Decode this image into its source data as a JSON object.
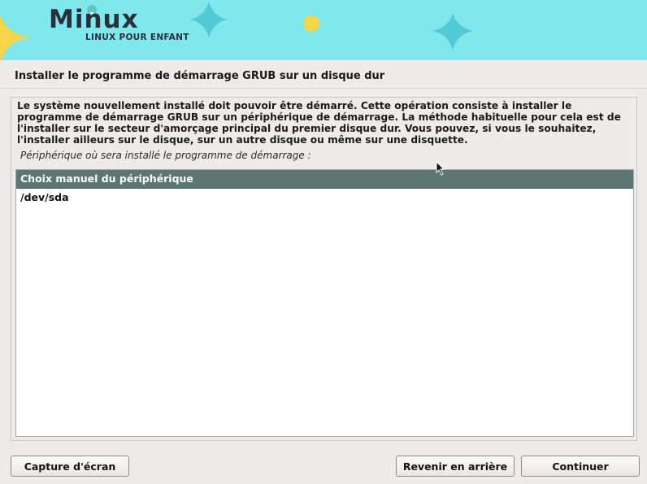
{
  "banner": {
    "logo_title": "Minux",
    "logo_subtitle": "LINUX POUR ENFANT"
  },
  "page": {
    "title": "Installer le programme de démarrage GRUB sur un disque dur"
  },
  "description": "Le système nouvellement installé doit pouvoir être démarré. Cette opération consiste à installer le programme de démarrage GRUB sur un périphérique de démarrage. La méthode habituelle pour cela est de l'installer sur le secteur d'amorçage principal du premier disque dur. Vous pouvez, si vous le souhaitez, l'installer ailleurs sur le disque, sur un autre disque ou même sur une disquette.",
  "prompt": "Périphérique où sera installé le programme de démarrage :",
  "device_list": {
    "items": [
      "Choix manuel du périphérique",
      "/dev/sda"
    ],
    "selected_index": 0
  },
  "buttons": {
    "screenshot": "Capture d'écran",
    "back": "Revenir en arrière",
    "continue": "Continuer"
  },
  "colors": {
    "banner_bg": "#7fe8ec",
    "selection": "#5c7672",
    "window_bg": "#edeceb"
  }
}
